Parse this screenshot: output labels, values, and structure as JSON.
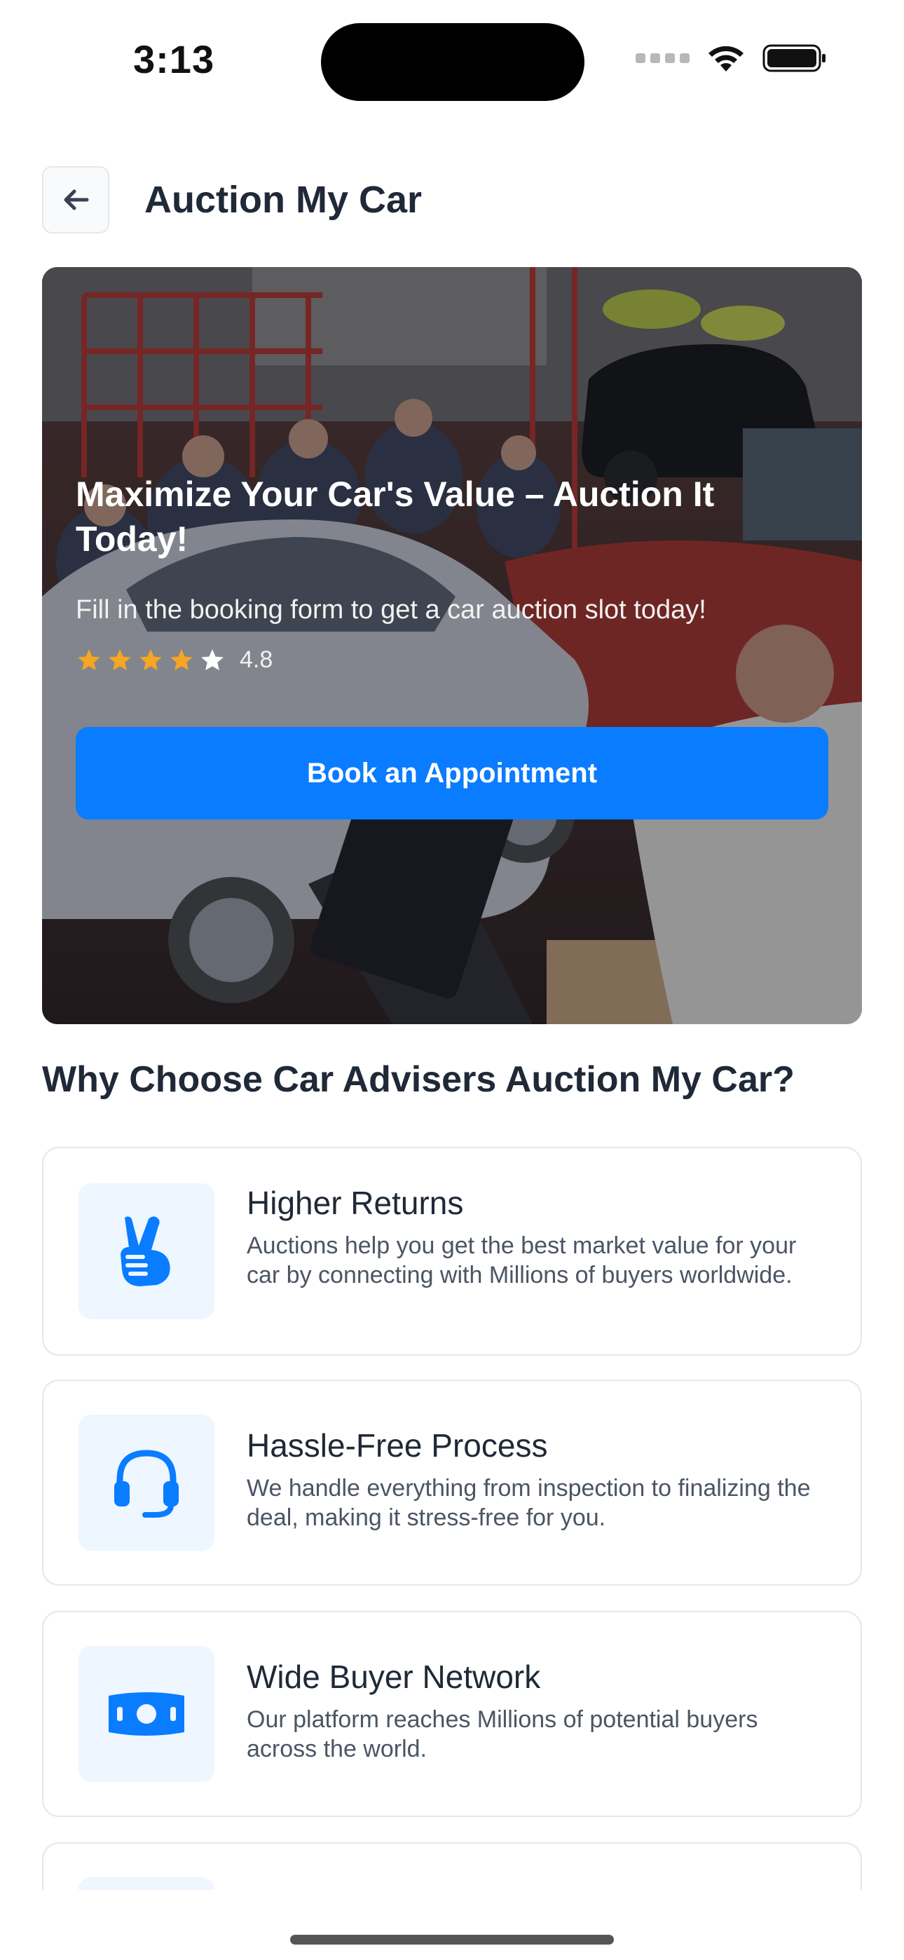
{
  "status_bar": {
    "time": "3:13"
  },
  "header": {
    "title": "Auction My Car",
    "back_icon": "arrow-left-icon"
  },
  "hero": {
    "title": "Maximize Your Car's Value – Auction It Today!",
    "subtitle": "Fill in the booking form to get a car auction slot today!",
    "rating": 4.8,
    "rating_label": "4.8",
    "stars_filled": 4,
    "stars_total": 5,
    "cta_label": "Book an Appointment",
    "accent_color": "#0a7cff",
    "star_color": "#f5a623"
  },
  "section": {
    "title": "Why Choose Car Advisers Auction My Car?",
    "features": [
      {
        "title": "Higher Returns",
        "description": "Auctions help you get the best market value for your car by connecting with Millions of buyers worldwide.",
        "icon": "victory-hand-icon"
      },
      {
        "title": "Hassle-Free Process",
        "description": "We handle everything from inspection to finalizing the deal, making it stress-free for you.",
        "icon": "headset-icon"
      },
      {
        "title": "Wide Buyer Network",
        "description": "Our platform reaches Millions of potential buyers across the world.",
        "icon": "money-bill-icon"
      }
    ]
  }
}
